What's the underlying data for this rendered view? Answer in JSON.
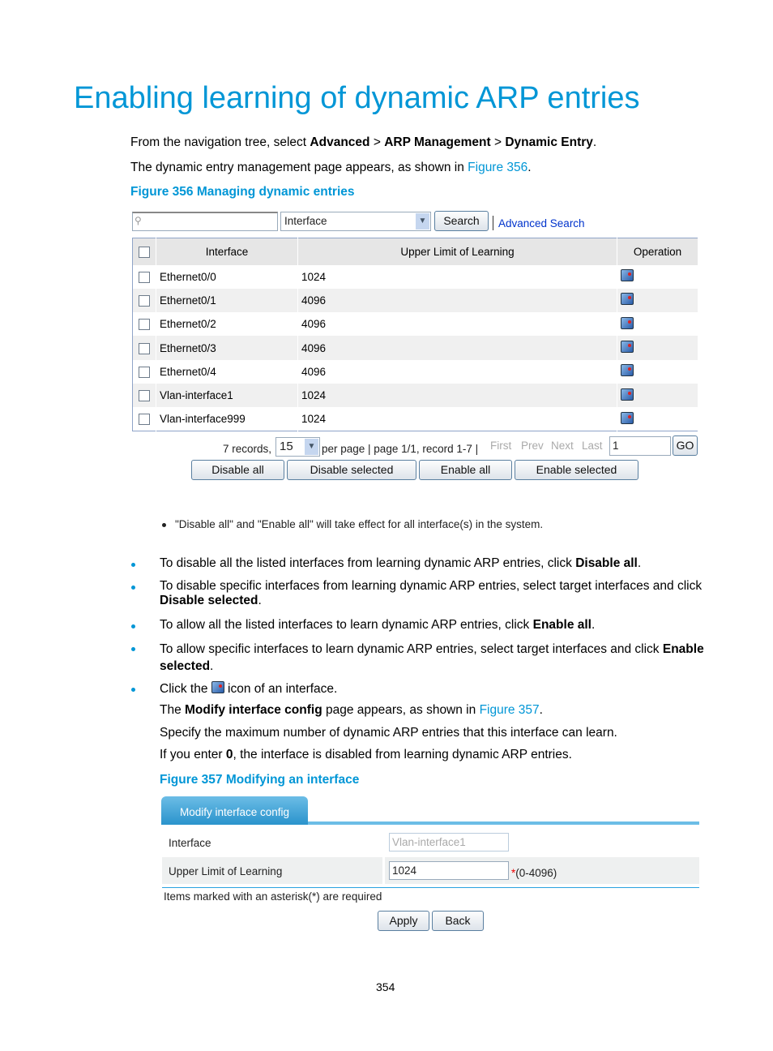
{
  "title": "Enabling learning of dynamic ARP entries",
  "intro": {
    "p1_pre": "From the navigation tree, select ",
    "nav1": "Advanced",
    "sep": " > ",
    "nav2": "ARP Management",
    "nav3": "Dynamic Entry",
    "p1_end": ".",
    "p2_pre": "The dynamic entry management page appears, as shown in ",
    "p2_link": "Figure 356",
    "p2_end": "."
  },
  "figure356": {
    "caption": "Figure 356 Managing dynamic entries",
    "search": {
      "value": "",
      "field": "Interface",
      "button": "Search",
      "advanced": "Advanced Search"
    },
    "columns": [
      "Interface",
      "Upper Limit of Learning",
      "Operation"
    ],
    "rows": [
      {
        "interface": "Ethernet0/0",
        "limit": "1024"
      },
      {
        "interface": "Ethernet0/1",
        "limit": "4096"
      },
      {
        "interface": "Ethernet0/2",
        "limit": "4096"
      },
      {
        "interface": "Ethernet0/3",
        "limit": "4096"
      },
      {
        "interface": "Ethernet0/4",
        "limit": "4096"
      },
      {
        "interface": "Vlan-interface1",
        "limit": "1024"
      },
      {
        "interface": "Vlan-interface999",
        "limit": "1024"
      }
    ],
    "pager": {
      "records": "7 records,",
      "per_page": "15",
      "info": "per page | page 1/1, record 1-7 |",
      "first": "First",
      "prev": "Prev",
      "next": "Next",
      "last": "Last",
      "page": "1",
      "go": "GO"
    },
    "buttons": [
      "Disable all",
      "Disable selected",
      "Enable all",
      "Enable selected"
    ],
    "note": "\"Disable all\" and \"Enable all\" will take effect for all interface(s) in the system."
  },
  "bullets": {
    "b1": {
      "pre": "To disable all the listed interfaces from learning dynamic ARP entries, click ",
      "bold": "Disable all",
      "end": "."
    },
    "b2": {
      "line1": "To disable specific interfaces from learning dynamic ARP entries, select target interfaces and click",
      "bold": "Disable selected",
      "end": "."
    },
    "b3": {
      "pre": "To allow all the listed interfaces to learn dynamic ARP entries, click ",
      "bold": "Enable all",
      "end": "."
    },
    "b4": {
      "pre": "To allow specific interfaces to learn dynamic ARP entries, select target interfaces and click ",
      "bold1": "Enable",
      "bold2": "selected",
      "end": "."
    },
    "b5": {
      "pre": "Click the ",
      "post": " icon of an interface."
    },
    "s1": {
      "pre": "The ",
      "bold": "Modify interface config",
      "mid": " page appears, as shown in ",
      "link": "Figure 357",
      "end": "."
    },
    "s2": "Specify the maximum number of dynamic ARP entries that this interface can learn.",
    "s3": {
      "pre": "If you enter ",
      "bold": "0",
      "end": ", the interface is disabled from learning dynamic ARP entries."
    }
  },
  "figure357": {
    "caption": "Figure 357 Modifying an interface",
    "tab": "Modify interface config",
    "interface_label": "Interface",
    "interface_value": "Vlan-interface1",
    "limit_label": "Upper Limit of Learning",
    "limit_value": "1024",
    "asterisk": "*",
    "range": "(0-4096)",
    "required_note": "Items marked with an asterisk(*) are required",
    "apply": "Apply",
    "back": "Back"
  },
  "page_number": "354",
  "colors": {
    "accent": "#0096d6",
    "tab": "#3aa0d4"
  }
}
